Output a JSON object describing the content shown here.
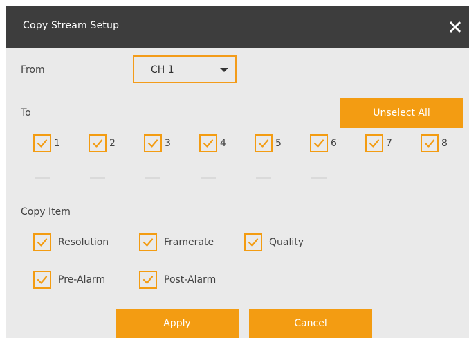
{
  "dialog": {
    "title": "Copy Stream Setup",
    "close_icon": "close-icon"
  },
  "from": {
    "label": "From",
    "selected": "CH 1"
  },
  "to": {
    "label": "To",
    "unselect_all": "Unselect All",
    "channels": [
      {
        "label": "1",
        "checked": true
      },
      {
        "label": "2",
        "checked": true
      },
      {
        "label": "3",
        "checked": true
      },
      {
        "label": "4",
        "checked": true
      },
      {
        "label": "5",
        "checked": true
      },
      {
        "label": "6",
        "checked": true
      },
      {
        "label": "7",
        "checked": true
      },
      {
        "label": "8",
        "checked": true
      }
    ]
  },
  "copy_item": {
    "label": "Copy Item",
    "items": [
      {
        "label": "Resolution",
        "checked": true
      },
      {
        "label": "Framerate",
        "checked": true
      },
      {
        "label": "Quality",
        "checked": true
      },
      {
        "label": "Pre-Alarm",
        "checked": true
      },
      {
        "label": "Post-Alarm",
        "checked": true
      }
    ]
  },
  "actions": {
    "apply": "Apply",
    "cancel": "Cancel"
  },
  "colors": {
    "accent": "#f39c12",
    "titlebar": "#3d3d3d",
    "panel": "#eaeaea"
  }
}
